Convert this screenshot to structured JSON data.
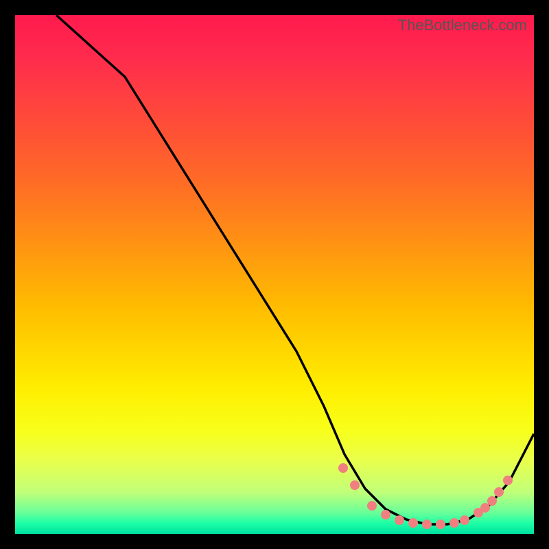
{
  "watermark": "TheBottleneck.com",
  "chart_data": {
    "type": "line",
    "title": "",
    "xlabel": "",
    "ylabel": "",
    "xlim": [
      0,
      100
    ],
    "ylim": [
      0,
      100
    ],
    "series": [
      {
        "name": "bottleneck-curve",
        "x": [
          0,
          8,
          15,
          25,
          35,
          45,
          55,
          62,
          66,
          70,
          74,
          78,
          82,
          86,
          90,
          94,
          100
        ],
        "values": [
          100,
          98,
          94,
          80,
          66,
          52,
          38,
          26,
          18,
          10,
          5,
          2,
          1,
          1,
          3,
          8,
          22
        ]
      }
    ],
    "markers": {
      "name": "optimal-range-dots",
      "color": "#f08080",
      "x": [
        62,
        66,
        70,
        72,
        74,
        76,
        78,
        80,
        82,
        84,
        86,
        88,
        90,
        92,
        94
      ],
      "values": [
        8,
        5,
        3,
        2,
        2,
        1,
        1,
        1,
        1,
        1,
        2,
        2,
        3,
        5,
        7
      ]
    },
    "gradient_stops": [
      {
        "pos": 0,
        "color": "#ff1a4d"
      },
      {
        "pos": 50,
        "color": "#ffbb00"
      },
      {
        "pos": 80,
        "color": "#ffee00"
      },
      {
        "pos": 96,
        "color": "#66ff99"
      },
      {
        "pos": 100,
        "color": "#00e0a0"
      }
    ]
  }
}
